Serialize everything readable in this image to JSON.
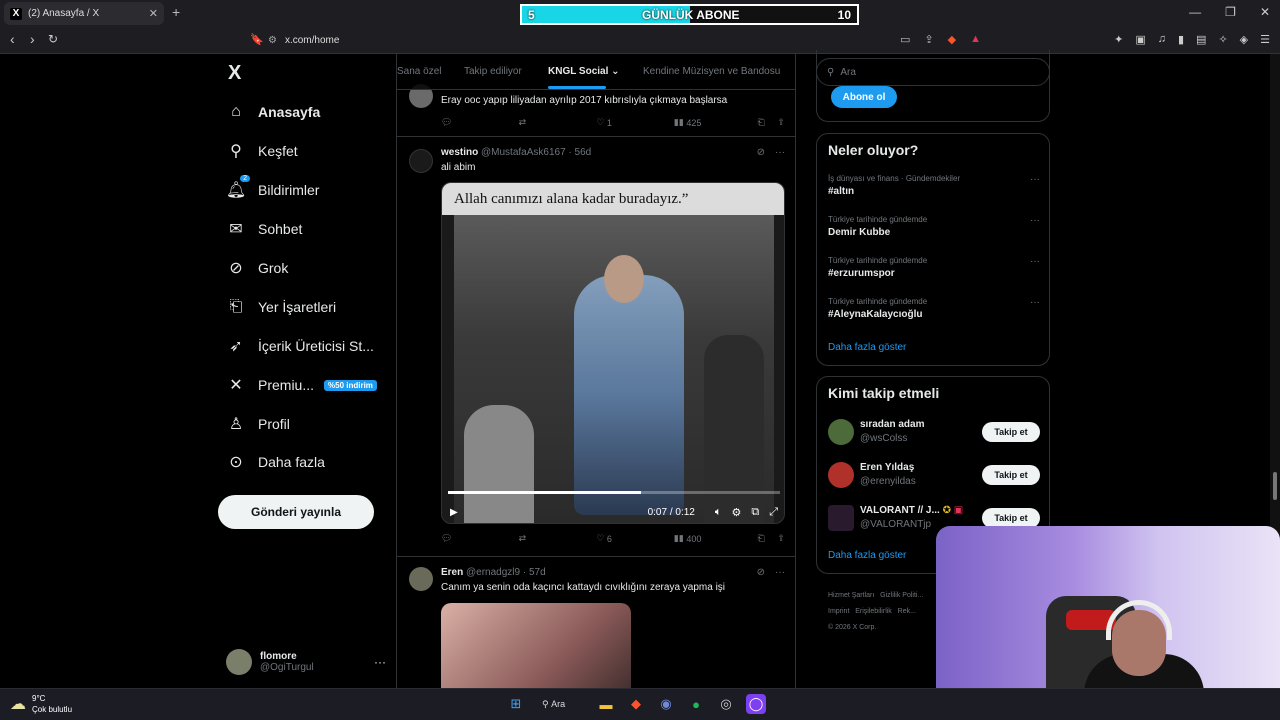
{
  "browser": {
    "tab_title": "(2) Anasayfa / X",
    "tab_favicon": "X",
    "url": "x.com/home",
    "new_tab": "+"
  },
  "overlay": {
    "left_number": "5",
    "label": "GÜNLÜK ABONE",
    "right_number": "10",
    "progress_fraction": 0.5,
    "fill_color": "#19d6e6"
  },
  "sidebar": {
    "logo": "X",
    "items": [
      {
        "label": "Anasayfa",
        "icon": "home-icon"
      },
      {
        "label": "Keşfet",
        "icon": "search-icon"
      },
      {
        "label": "Bildirimler",
        "icon": "bell-icon",
        "badge": "2"
      },
      {
        "label": "Sohbet",
        "icon": "mail-icon"
      },
      {
        "label": "Grok",
        "icon": "grok-icon"
      },
      {
        "label": "Yer İşaretleri",
        "icon": "bookmark-icon"
      },
      {
        "label": "İçerik Üreticisi St...",
        "icon": "rocket-icon"
      },
      {
        "label": "Premiu...",
        "icon": "x-premium-icon",
        "promo": "%50 indirim"
      },
      {
        "label": "Profil",
        "icon": "person-icon"
      },
      {
        "label": "Daha fazla",
        "icon": "more-circle-icon"
      }
    ],
    "post_button": "Gönderi yayınla",
    "account": {
      "name": "flomore",
      "handle": "@OgiTurgul",
      "more": "···"
    }
  },
  "timeline": {
    "tabs": [
      {
        "label": "Sana özel"
      },
      {
        "label": "Takip ediliyor"
      },
      {
        "label": "KNGL Social ⌄",
        "active": true
      },
      {
        "label": "Kendine Müzisyen ve Bandosu"
      }
    ],
    "tweets": [
      {
        "text": "Eray ooc yapıp liliyadan ayrılıp 2017 kıbrıslıyla çıkmaya başlarsa",
        "replies": "",
        "retweets": "",
        "likes": "1",
        "views": "425"
      },
      {
        "name": "westino",
        "handle": "@MustafaAsk6167 · 56d",
        "text": "ali abim",
        "video_caption": "Allah canımızı alana kadar buradayız.”",
        "video_time": "0:07 / 0:12",
        "video_progress": 0.58,
        "replies": "",
        "retweets": "",
        "likes": "6",
        "views": "400"
      },
      {
        "name": "Eren",
        "handle": "@ernadgzl9 · 57d",
        "text": "Canım ya senin oda kaçıncı kattaydı cıvıklığını zeraya yapma işi"
      }
    ]
  },
  "right": {
    "search_placeholder": "Ara",
    "subscribe_button": "Abone ol",
    "trends_title": "Neler oluyor?",
    "trends": [
      {
        "context": "İş dünyası ve finans · Gündemdekiler",
        "topic": "#altın"
      },
      {
        "context": "Türkiye tarihinde gündemde",
        "topic": "Demir Kubbe"
      },
      {
        "context": "Türkiye tarihinde gündemde",
        "topic": "#erzurumspor"
      },
      {
        "context": "Türkiye tarihinde gündemde",
        "topic": "#AleynaKalaycıoğlu"
      }
    ],
    "trends_more": "Daha fazla göster",
    "who_title": "Kimi takip etmeli",
    "who": [
      {
        "name": "sıradan adam",
        "handle": "@wsColss",
        "button": "Takip et",
        "avatar_color": "#4d6b3a"
      },
      {
        "name": "Eren Yıldaş",
        "handle": "@erenyildas",
        "button": "Takip et",
        "avatar_color": "#b0302a"
      },
      {
        "name": "VALORANT // J...",
        "handle": "@VALORANTjp",
        "button": "Takip et",
        "avatar_color": "#2a1a2e"
      }
    ],
    "who_more": "Daha fazla göster",
    "footer": [
      "Hizmet Şartları",
      "Gizlilik Politi...",
      "Imprint",
      "Erişilebilirlik",
      "Rek...",
      "© 2026 X Corp."
    ]
  },
  "taskbar": {
    "temp": "9°C",
    "weather": "Çok bulutlu",
    "search": "Ara"
  }
}
